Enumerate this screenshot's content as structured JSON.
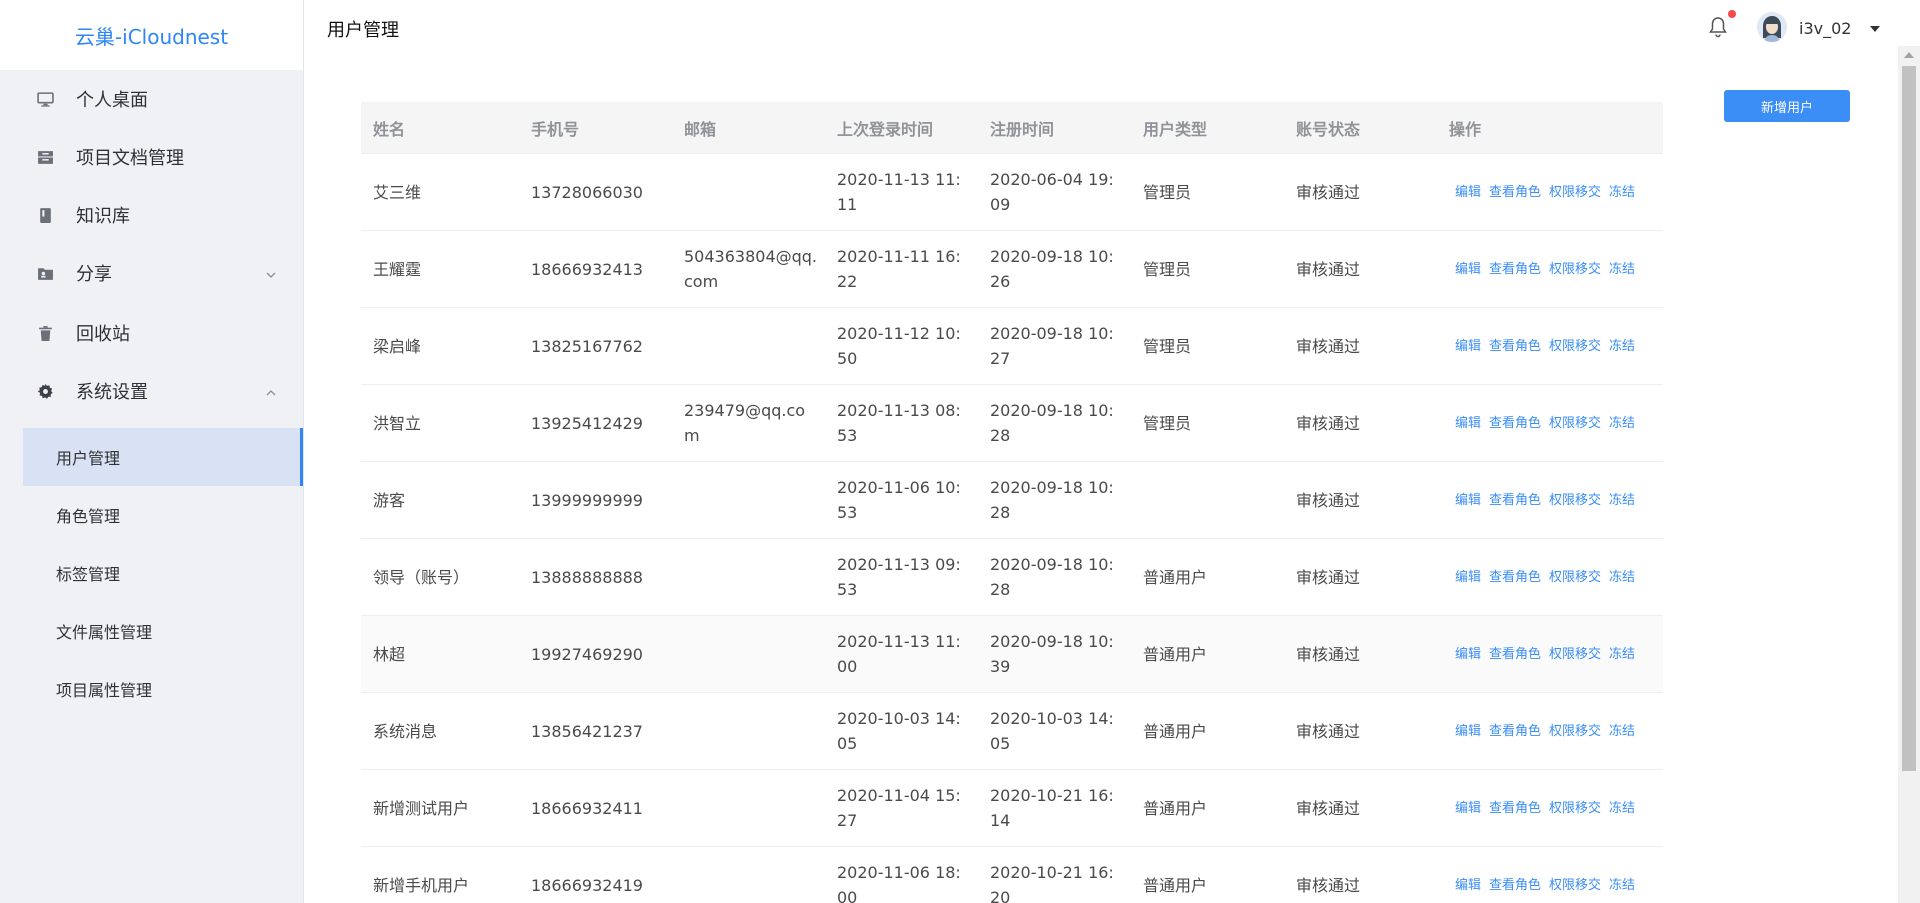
{
  "brand": "云巢-iCloudnest",
  "sidebar": {
    "items": [
      {
        "label": "个人桌面"
      },
      {
        "label": "项目文档管理"
      },
      {
        "label": "知识库"
      },
      {
        "label": "分享"
      },
      {
        "label": "回收站"
      },
      {
        "label": "系统设置"
      }
    ],
    "sub_items": [
      {
        "label": "用户管理"
      },
      {
        "label": "角色管理"
      },
      {
        "label": "标签管理"
      },
      {
        "label": "文件属性管理"
      },
      {
        "label": "项目属性管理"
      }
    ]
  },
  "header": {
    "title": "用户管理",
    "username": "i3v_02"
  },
  "toolbar": {
    "add_label": "新增用户"
  },
  "table": {
    "columns": [
      "姓名",
      "手机号",
      "邮箱",
      "上次登录时间",
      "注册时间",
      "用户类型",
      "账号状态",
      "操作"
    ],
    "actions": [
      "编辑",
      "查看角色",
      "权限移交",
      "冻结"
    ],
    "rows": [
      {
        "name": "艾三维",
        "phone": "13728066030",
        "email": "",
        "last_login": "2020-11-13 11:11",
        "registered": "2020-06-04 19:09",
        "type": "管理员",
        "status": "审核通过"
      },
      {
        "name": "王耀霆",
        "phone": "18666932413",
        "email": "504363804@qq.com",
        "last_login": "2020-11-11 16:22",
        "registered": "2020-09-18 10:26",
        "type": "管理员",
        "status": "审核通过"
      },
      {
        "name": "梁启峰",
        "phone": "13825167762",
        "email": "",
        "last_login": "2020-11-12 10:50",
        "registered": "2020-09-18 10:27",
        "type": "管理员",
        "status": "审核通过"
      },
      {
        "name": "洪智立",
        "phone": "13925412429",
        "email": "239479@qq.com",
        "last_login": "2020-11-13 08:53",
        "registered": "2020-09-18 10:28",
        "type": "管理员",
        "status": "审核通过"
      },
      {
        "name": "游客",
        "phone": "13999999999",
        "email": "",
        "last_login": "2020-11-06 10:53",
        "registered": "2020-09-18 10:28",
        "type": "",
        "status": "审核通过"
      },
      {
        "name": "领导（账号）",
        "phone": "13888888888",
        "email": "",
        "last_login": "2020-11-13 09:53",
        "registered": "2020-09-18 10:28",
        "type": "普通用户",
        "status": "审核通过"
      },
      {
        "name": "林超",
        "phone": "19927469290",
        "email": "",
        "last_login": "2020-11-13 11:00",
        "registered": "2020-09-18 10:39",
        "type": "普通用户",
        "status": "审核通过"
      },
      {
        "name": "系统消息",
        "phone": "13856421237",
        "email": "",
        "last_login": "2020-10-03 14:05",
        "registered": "2020-10-03 14:05",
        "type": "普通用户",
        "status": "审核通过"
      },
      {
        "name": "新增测试用户",
        "phone": "18666932411",
        "email": "",
        "last_login": "2020-11-04 15:27",
        "registered": "2020-10-21 16:14",
        "type": "普通用户",
        "status": "审核通过"
      },
      {
        "name": "新增手机用户",
        "phone": "18666932419",
        "email": "",
        "last_login": "2020-11-06 18:00",
        "registered": "2020-10-21 16:20",
        "type": "普通用户",
        "status": "审核通过"
      }
    ]
  },
  "colors": {
    "accent": "#2f86f6",
    "button": "#3a8ef6",
    "sidebar_bg": "#eff1f5",
    "active_bg": "#d9e2f4",
    "badge": "#f5484a"
  }
}
